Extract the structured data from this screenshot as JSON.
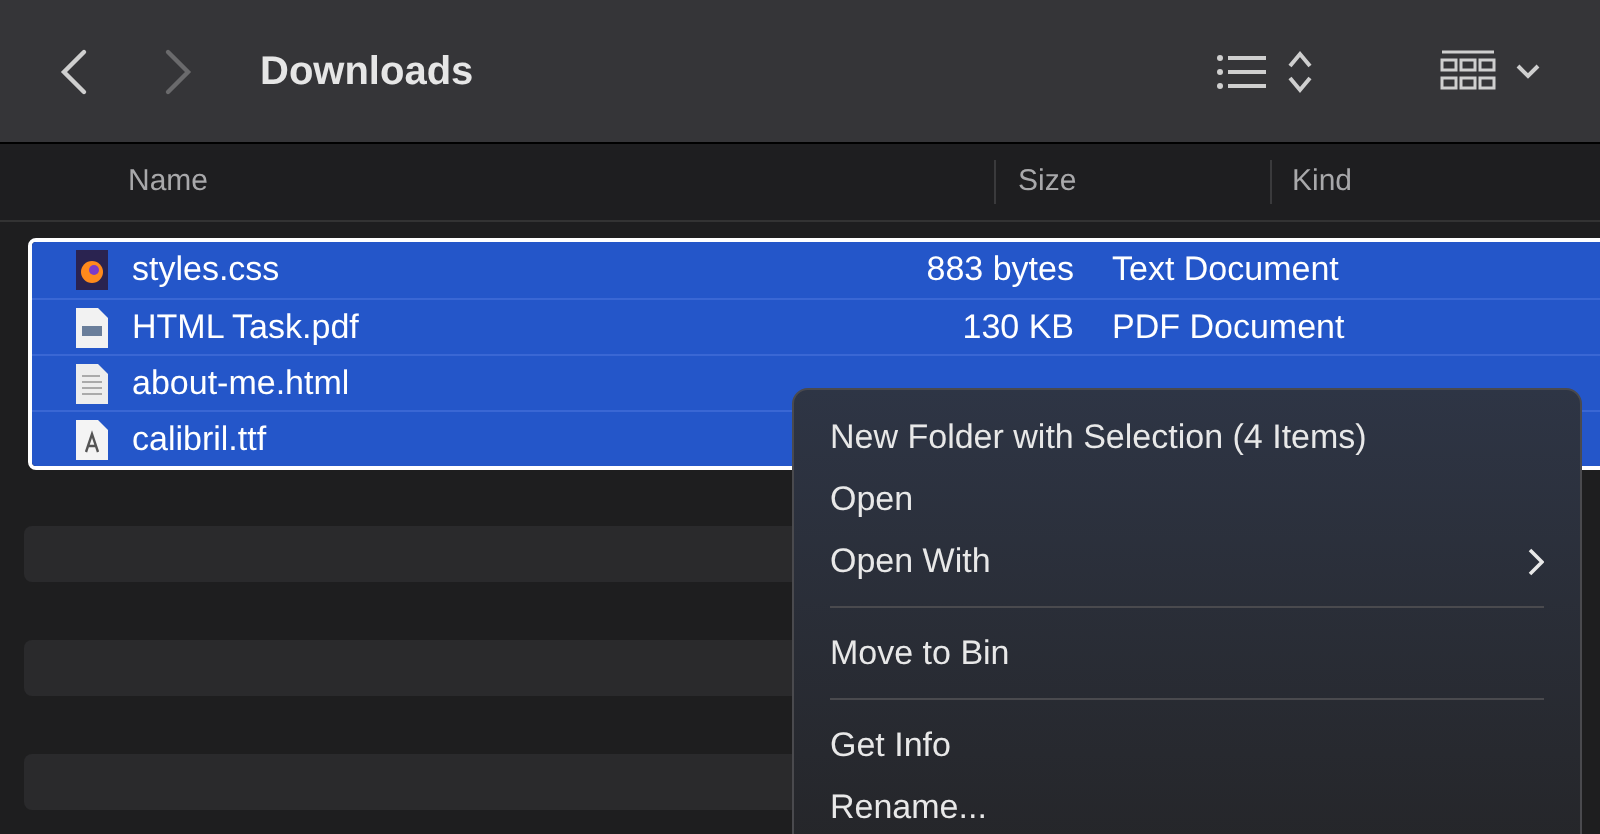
{
  "toolbar": {
    "title": "Downloads"
  },
  "columns": [
    "Name",
    "Size",
    "Kind"
  ],
  "rows": [
    {
      "kind": "firefox",
      "name": "styles.css",
      "size": "883 bytes",
      "type": "Text Document",
      "selected": true
    },
    {
      "kind": "pdf",
      "name": "HTML Task.pdf",
      "size": "130 KB",
      "type": "PDF Document",
      "selected": true
    },
    {
      "kind": "doc",
      "name": "about-me.html",
      "selected": true
    },
    {
      "kind": "font",
      "name": "calibril.ttf",
      "selected": true
    }
  ],
  "context_menu": [
    {
      "kind": "item",
      "label": "New Folder with Selection (4 Items)",
      "submenu": false
    },
    {
      "kind": "item",
      "label": "Open",
      "submenu": false
    },
    {
      "kind": "item",
      "label": "Open With",
      "submenu": true
    },
    {
      "kind": "separator"
    },
    {
      "kind": "item",
      "label": "Move to Bin",
      "submenu": false
    },
    {
      "kind": "separator"
    },
    {
      "kind": "item",
      "label": "Get Info",
      "submenu": false
    },
    {
      "kind": "item",
      "label": "Rename...",
      "submenu": false
    }
  ]
}
